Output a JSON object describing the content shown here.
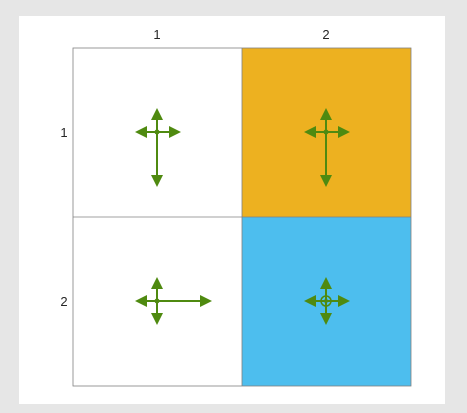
{
  "grid": {
    "col_labels": [
      "1",
      "2"
    ],
    "row_labels": [
      "1",
      "2"
    ],
    "cells": [
      {
        "row": 1,
        "col": 1,
        "color": "#ffffff",
        "arrows": {
          "up": "short",
          "down": "long",
          "left": "short",
          "right": "short"
        },
        "circle": false
      },
      {
        "row": 1,
        "col": 2,
        "color": "#edb120",
        "arrows": {
          "up": "short",
          "down": "long",
          "left": "short",
          "right": "short"
        },
        "circle": false
      },
      {
        "row": 2,
        "col": 1,
        "color": "#ffffff",
        "arrows": {
          "up": "short",
          "down": "short",
          "left": "short",
          "right": "long"
        },
        "circle": false
      },
      {
        "row": 2,
        "col": 2,
        "color": "#4dbeee",
        "arrows": {
          "up": "short",
          "down": "short",
          "left": "short",
          "right": "short"
        },
        "circle": true
      }
    ]
  },
  "colors": {
    "arrow": "#4f8a10",
    "grid_line": "#808080",
    "background": "#e6e6e6"
  }
}
